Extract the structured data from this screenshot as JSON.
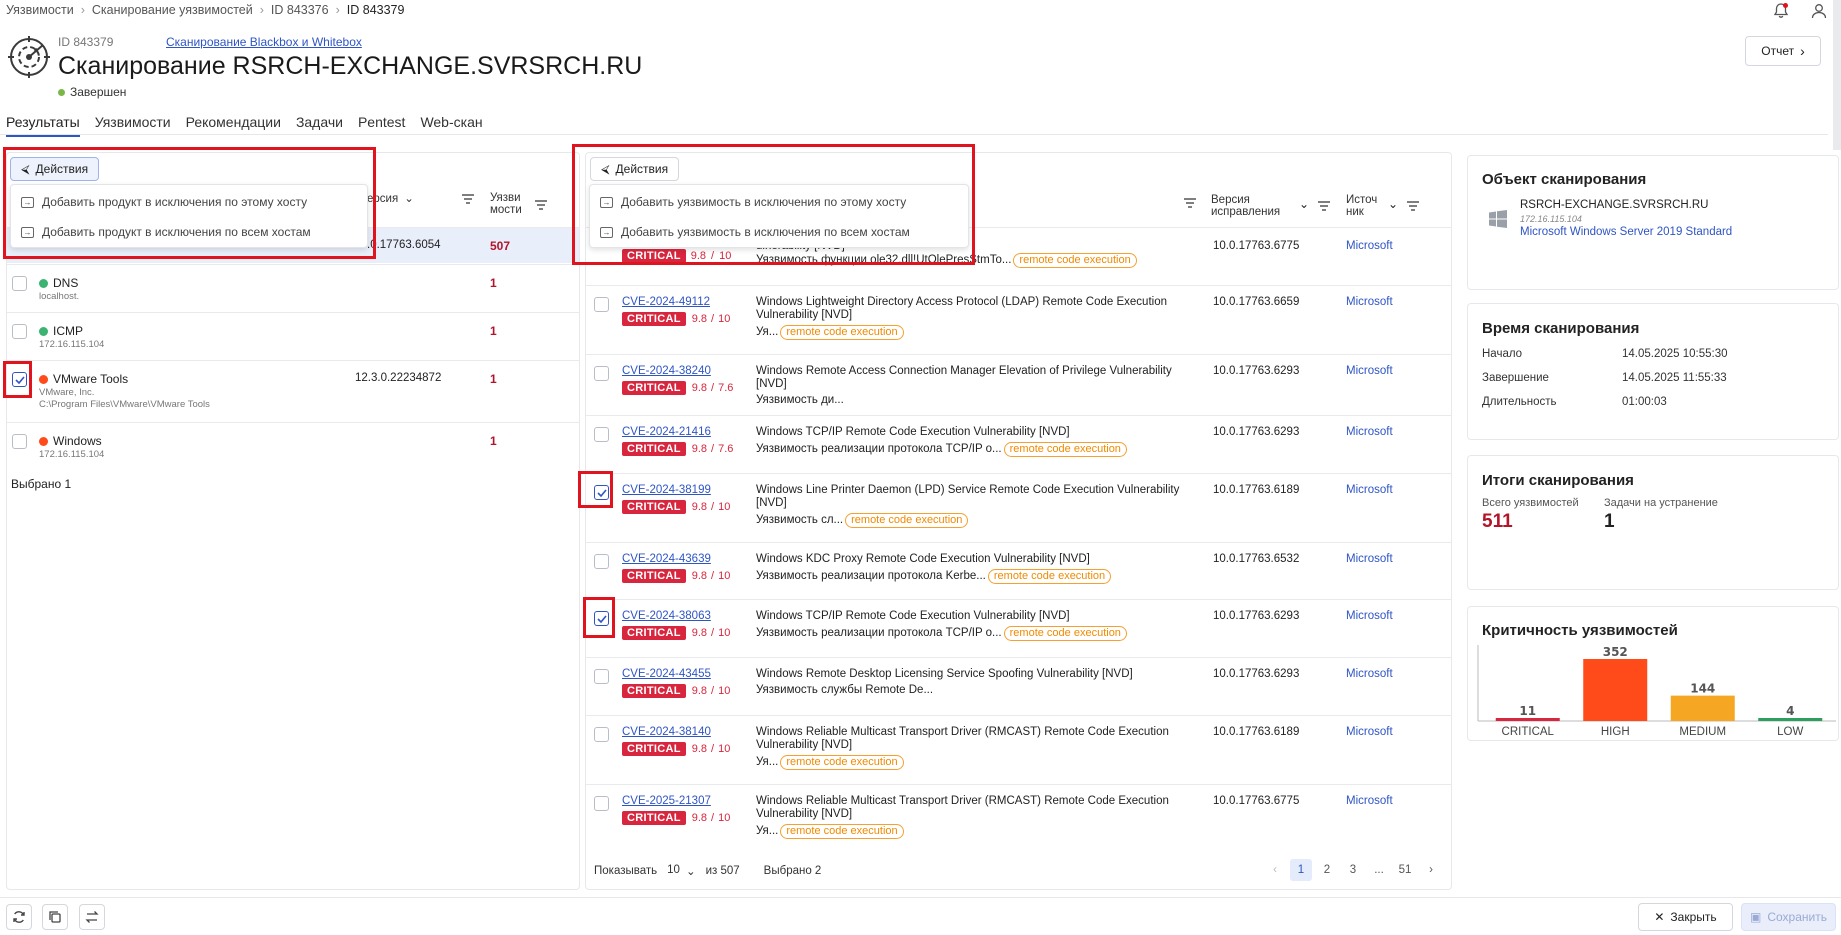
{
  "breadcrumbs": [
    "Уязвимости",
    "Сканирование уязвимостей",
    "ID 843376",
    "ID 843379"
  ],
  "header": {
    "id_label": "ID 843379",
    "type_link": "Сканирование Blackbox и Whitebox",
    "title": "Сканирование RSRCH-EXCHANGE.SVRSRCH.RU",
    "status": "Завершен",
    "report_button": "Отчет"
  },
  "tabs": [
    "Результаты",
    "Уязвимости",
    "Рекомендации",
    "Задачи",
    "Pentest",
    "Web-скан"
  ],
  "left": {
    "actions_label": "Действия",
    "menu": [
      "Добавить продукт в исключения по этому хосту",
      "Добавить продукт в исключения по всем хостам"
    ],
    "col_version": "ерсия",
    "col_vulns_1": "Уязви",
    "col_vulns_2": "мости",
    "first_row_version": ".0.17763.6054",
    "first_row_count": "507",
    "rows": [
      {
        "name": "DNS",
        "sub": "localhost.",
        "sub2": "",
        "version": "",
        "count": "1"
      },
      {
        "name": "ICMP",
        "sub": "172.16.115.104",
        "sub2": "",
        "version": "",
        "count": "1"
      },
      {
        "name": "VMware Tools",
        "sub": "VMware, Inc.",
        "sub2": "C:\\Program Files\\VMware\\VMware Tools",
        "version": "12.3.0.22234872",
        "count": "1"
      },
      {
        "name": "Windows",
        "sub": "172.16.115.104",
        "sub2": "",
        "version": "",
        "count": "1"
      }
    ],
    "selected": "Выбрано 1"
  },
  "mid": {
    "actions_label": "Действия",
    "menu": [
      "Добавить уязвимость в исключения по этому хосту",
      "Добавить уязвимость в исключения по всем хостам"
    ],
    "col_fix_1": "Версия",
    "col_fix_2": "исправления",
    "col_src_1": "Источ",
    "col_src_2": "ник",
    "first_row": {
      "desc1": "ulnerability [NVD]",
      "desc2": "Уязвимость функции ole32.dll!UtOlePresStmTo...",
      "tag": "remote code execution",
      "version": "10.0.17763.6775",
      "source": "Microsoft",
      "crit": "CRITICAL",
      "score_a": "9.8",
      "score_b": "10"
    },
    "rows": [
      {
        "cve": "CVE-2024-49112",
        "crit": "CRITICAL",
        "score_a": "9.8",
        "score_b": "10",
        "desc1": "Windows Lightweight Directory Access Protocol (LDAP) Remote Code Execution",
        "desc2": "Vulnerability [NVD]",
        "sub": "Уя...",
        "tag": "remote code execution",
        "version": "10.0.17763.6659",
        "source": "Microsoft",
        "checked": false
      },
      {
        "cve": "CVE-2024-38240",
        "crit": "CRITICAL",
        "score_a": "9.8",
        "score_b": "7.6",
        "desc1": "Windows Remote Access Connection Manager Elevation of Privilege Vulnerability",
        "desc2": "[NVD]",
        "sub": "Уязвимость ди...",
        "tag": "",
        "version": "10.0.17763.6293",
        "source": "Microsoft",
        "checked": false
      },
      {
        "cve": "CVE-2024-21416",
        "crit": "CRITICAL",
        "score_a": "9.8",
        "score_b": "7.6",
        "desc1": "Windows TCP/IP Remote Code Execution Vulnerability [NVD]",
        "desc2": "",
        "sub": "Уязвимость реализации протокола TCP/IP о...",
        "tag": "remote code execution",
        "version": "10.0.17763.6293",
        "source": "Microsoft",
        "checked": false
      },
      {
        "cve": "CVE-2024-38199",
        "crit": "CRITICAL",
        "score_a": "9.8",
        "score_b": "10",
        "desc1": "Windows Line Printer Daemon (LPD) Service Remote Code Execution Vulnerability",
        "desc2": "[NVD]",
        "sub": "Уязвимость сл...",
        "tag": "remote code execution",
        "version": "10.0.17763.6189",
        "source": "Microsoft",
        "checked": true
      },
      {
        "cve": "CVE-2024-43639",
        "crit": "CRITICAL",
        "score_a": "9.8",
        "score_b": "10",
        "desc1": "Windows KDC Proxy Remote Code Execution Vulnerability [NVD]",
        "desc2": "",
        "sub": "Уязвимость реализации протокола Kerbe...",
        "tag": "remote code execution",
        "version": "10.0.17763.6532",
        "source": "Microsoft",
        "checked": false
      },
      {
        "cve": "CVE-2024-38063",
        "crit": "CRITICAL",
        "score_a": "9.8",
        "score_b": "10",
        "desc1": "Windows TCP/IP Remote Code Execution Vulnerability [NVD]",
        "desc2": "",
        "sub": "Уязвимость реализации протокола TCP/IP о...",
        "tag": "remote code execution",
        "version": "10.0.17763.6293",
        "source": "Microsoft",
        "checked": true
      },
      {
        "cve": "CVE-2024-43455",
        "crit": "CRITICAL",
        "score_a": "9.8",
        "score_b": "10",
        "desc1": "Windows Remote Desktop Licensing Service Spoofing Vulnerability [NVD]",
        "desc2": "",
        "sub": "Уязвимость службы Remote De...",
        "tag": "",
        "version": "10.0.17763.6293",
        "source": "Microsoft",
        "checked": false
      },
      {
        "cve": "CVE-2024-38140",
        "crit": "CRITICAL",
        "score_a": "9.8",
        "score_b": "10",
        "desc1": "Windows Reliable Multicast Transport Driver (RMCAST) Remote Code Execution",
        "desc2": "Vulnerability [NVD]",
        "sub": "Уя...",
        "tag": "remote code execution",
        "version": "10.0.17763.6189",
        "source": "Microsoft",
        "checked": false
      },
      {
        "cve": "CVE-2025-21307",
        "crit": "CRITICAL",
        "score_a": "9.8",
        "score_b": "10",
        "desc1": "Windows Reliable Multicast Transport Driver (RMCAST) Remote Code Execution",
        "desc2": "Vulnerability [NVD]",
        "sub": "Уя...",
        "tag": "remote code execution",
        "version": "10.0.17763.6775",
        "source": "Microsoft",
        "checked": false
      }
    ],
    "footer": {
      "show_label": "Показывать",
      "page_size": "10",
      "of_total": "из 507",
      "selected": "Выбрано 2",
      "pages": [
        "1",
        "2",
        "3",
        "...",
        "51"
      ]
    }
  },
  "right": {
    "object": {
      "title": "Объект сканирования",
      "host": "RSRCH-EXCHANGE.SVRSRCH.RU",
      "ip": "172.16.115.104",
      "os": "Microsoft Windows Server 2019 Standard"
    },
    "time": {
      "title": "Время сканирования",
      "start_label": "Начало",
      "start": "14.05.2025 10:55:30",
      "end_label": "Завершение",
      "end": "14.05.2025 11:55:33",
      "dur_label": "Длительность",
      "dur": "01:00:03"
    },
    "results": {
      "title": "Итоги сканирования",
      "total_label": "Всего уязвимостей",
      "total": "511",
      "tasks_label": "Задачи на устранение",
      "tasks": "1"
    },
    "severity": {
      "title": "Критичность уязвимостей"
    }
  },
  "chart_data": {
    "type": "bar",
    "title": "Критичность уязвимостей",
    "categories": [
      "CRITICAL",
      "HIGH",
      "MEDIUM",
      "LOW"
    ],
    "values": [
      11,
      352,
      144,
      4
    ],
    "colors": [
      "#d7263d",
      "#ff4a1a",
      "#f5a623",
      "#2e9e5e"
    ]
  },
  "bottom": {
    "close": "Закрыть",
    "save": "Сохранить"
  },
  "colors": {
    "accent": "#2f55c4",
    "critical": "#d7263d",
    "tag": "#f08a00",
    "highlight": "#e0141e"
  }
}
